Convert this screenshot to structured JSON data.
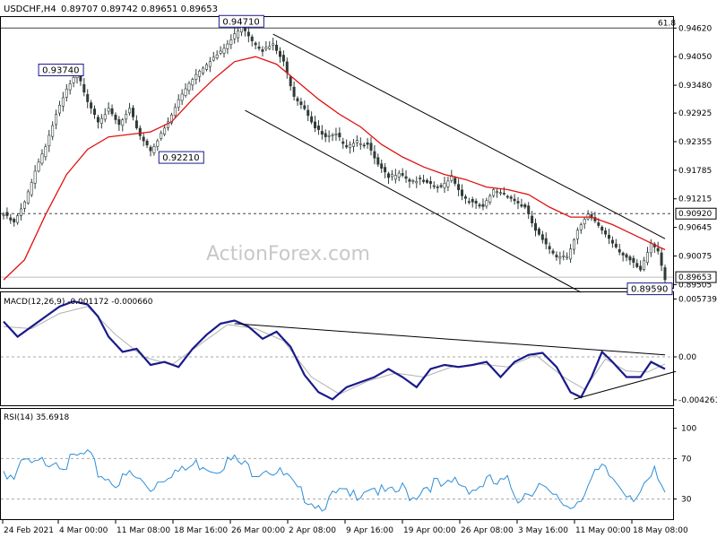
{
  "header": {
    "symbol": "USDCHF,H4",
    "ohlc": "0.89707 0.89742 0.89651 0.89653"
  },
  "watermark": "ActionForex.com",
  "colors": {
    "background": "#ffffff",
    "candles": "#2e3a36",
    "ema": "#e01010",
    "channel": "#000000",
    "macd": "#1a1a8c",
    "signal": "#b0b0b0",
    "rsi": "#2f8fd8",
    "level": "#444444",
    "label_border": "#1a1a8c"
  },
  "chart_data": [
    {
      "type": "candlestick",
      "name": "price",
      "ylim": [
        0.8944,
        0.9484
      ],
      "price_ticks": [
        "0.94620",
        "0.94050",
        "0.93480",
        "0.92925",
        "0.92355",
        "0.91785",
        "0.91215",
        "0.90645",
        "0.90075",
        "0.89505"
      ],
      "fib_label": "61.8",
      "fib_level": 0.9462,
      "h_level": 0.9092,
      "h_level_label": "0.90920",
      "current_price_label": "0.89653",
      "current_price": 0.89653,
      "annotations": [
        {
          "text": "0.94710",
          "value": 0.9471,
          "date": "26 Mar 00:00"
        },
        {
          "text": "0.93740",
          "value": 0.9374,
          "date": "4 Mar 00:00"
        },
        {
          "text": "0.92210",
          "value": 0.9221,
          "date": "18 Mar 16:00"
        },
        {
          "text": "0.89590",
          "value": 0.8959,
          "date": "18 May 08:00"
        }
      ],
      "x_labels": [
        "24 Feb 2021",
        "4 Mar 00:00",
        "11 Mar 08:00",
        "18 Mar 16:00",
        "26 Mar 00:00",
        "2 Apr 08:00",
        "9 Apr 16:00",
        "19 Apr 00:00",
        "26 Apr 08:00",
        "3 May 16:00",
        "11 May 00:00",
        "18 May 08:00"
      ],
      "price_path": [
        [
          0,
          0.9092
        ],
        [
          3,
          0.9075
        ],
        [
          6,
          0.9115
        ],
        [
          9,
          0.918
        ],
        [
          12,
          0.923
        ],
        [
          15,
          0.929
        ],
        [
          18,
          0.934
        ],
        [
          21,
          0.9374
        ],
        [
          24,
          0.932
        ],
        [
          27,
          0.928
        ],
        [
          30,
          0.93
        ],
        [
          33,
          0.927
        ],
        [
          36,
          0.93
        ],
        [
          39,
          0.925
        ],
        [
          42,
          0.9221
        ],
        [
          44,
          0.924
        ],
        [
          47,
          0.9275
        ],
        [
          50,
          0.932
        ],
        [
          53,
          0.9355
        ],
        [
          56,
          0.938
        ],
        [
          59,
          0.94
        ],
        [
          62,
          0.9415
        ],
        [
          65,
          0.944
        ],
        [
          68,
          0.9471
        ],
        [
          71,
          0.944
        ],
        [
          74,
          0.942
        ],
        [
          77,
          0.943
        ],
        [
          80,
          0.9395
        ],
        [
          83,
          0.933
        ],
        [
          86,
          0.9305
        ],
        [
          89,
          0.9265
        ],
        [
          92,
          0.9245
        ],
        [
          95,
          0.925
        ],
        [
          98,
          0.923
        ],
        [
          101,
          0.924
        ],
        [
          104,
          0.923
        ],
        [
          107,
          0.919
        ],
        [
          110,
          0.9165
        ],
        [
          113,
          0.9178
        ],
        [
          116,
          0.916
        ],
        [
          119,
          0.916
        ],
        [
          122,
          0.915
        ],
        [
          125,
          0.9145
        ],
        [
          128,
          0.917
        ],
        [
          131,
          0.913
        ],
        [
          134,
          0.9115
        ],
        [
          137,
          0.9105
        ],
        [
          140,
          0.914
        ],
        [
          143,
          0.9135
        ],
        [
          146,
          0.912
        ],
        [
          149,
          0.9105
        ],
        [
          152,
          0.906
        ],
        [
          155,
          0.903
        ],
        [
          158,
          0.901
        ],
        [
          161,
          0.901
        ],
        [
          164,
          0.906
        ],
        [
          167,
          0.909
        ],
        [
          170,
          0.907
        ],
        [
          173,
          0.9045
        ],
        [
          176,
          0.902
        ],
        [
          179,
          0.9
        ],
        [
          182,
          0.8979
        ],
        [
          185,
          0.9035
        ],
        [
          187,
          0.902
        ],
        [
          189,
          0.8965
        ]
      ],
      "ema_path": [
        [
          0,
          0.896
        ],
        [
          6,
          0.9
        ],
        [
          12,
          0.909
        ],
        [
          18,
          0.917
        ],
        [
          24,
          0.922
        ],
        [
          30,
          0.9245
        ],
        [
          36,
          0.925
        ],
        [
          42,
          0.9255
        ],
        [
          48,
          0.9275
        ],
        [
          54,
          0.932
        ],
        [
          60,
          0.936
        ],
        [
          66,
          0.9395
        ],
        [
          72,
          0.9405
        ],
        [
          78,
          0.939
        ],
        [
          84,
          0.9355
        ],
        [
          90,
          0.932
        ],
        [
          96,
          0.929
        ],
        [
          102,
          0.9265
        ],
        [
          108,
          0.923
        ],
        [
          114,
          0.9205
        ],
        [
          120,
          0.9185
        ],
        [
          126,
          0.917
        ],
        [
          132,
          0.916
        ],
        [
          138,
          0.9145
        ],
        [
          144,
          0.914
        ],
        [
          150,
          0.913
        ],
        [
          156,
          0.9105
        ],
        [
          162,
          0.9085
        ],
        [
          168,
          0.9085
        ],
        [
          174,
          0.907
        ],
        [
          180,
          0.905
        ],
        [
          186,
          0.903
        ],
        [
          189,
          0.902
        ]
      ],
      "channel_upper": [
        [
          77,
          0.945
        ],
        [
          189,
          0.9042
        ]
      ],
      "channel_lower": [
        [
          69,
          0.9298
        ],
        [
          165,
          0.8935
        ]
      ]
    },
    {
      "type": "line",
      "name": "MACD(12,26,9)",
      "header": "MACD(12,26,9) -0.001172 -0.000660",
      "ylim": [
        -0.0048,
        0.0064
      ],
      "ticks": [
        "0.005739",
        "0.00",
        "-0.004261"
      ],
      "macd_path": [
        [
          0,
          0.0035
        ],
        [
          4,
          0.002
        ],
        [
          8,
          0.003
        ],
        [
          12,
          0.004
        ],
        [
          16,
          0.005
        ],
        [
          20,
          0.0055
        ],
        [
          24,
          0.0052
        ],
        [
          27,
          0.004
        ],
        [
          30,
          0.002
        ],
        [
          34,
          0.0005
        ],
        [
          38,
          0.0008
        ],
        [
          42,
          -0.0008
        ],
        [
          46,
          -0.0005
        ],
        [
          50,
          -0.001
        ],
        [
          54,
          0.0008
        ],
        [
          58,
          0.0022
        ],
        [
          62,
          0.0033
        ],
        [
          66,
          0.0036
        ],
        [
          70,
          0.003
        ],
        [
          74,
          0.0018
        ],
        [
          78,
          0.0025
        ],
        [
          82,
          0.001
        ],
        [
          86,
          -0.0018
        ],
        [
          90,
          -0.0035
        ],
        [
          94,
          -0.0042
        ],
        [
          98,
          -0.003
        ],
        [
          102,
          -0.0025
        ],
        [
          106,
          -0.002
        ],
        [
          110,
          -0.0012
        ],
        [
          114,
          -0.002
        ],
        [
          118,
          -0.003
        ],
        [
          122,
          -0.0012
        ],
        [
          126,
          -0.0008
        ],
        [
          130,
          -0.001
        ],
        [
          134,
          -0.0008
        ],
        [
          138,
          -0.0005
        ],
        [
          142,
          -0.002
        ],
        [
          146,
          -0.0005
        ],
        [
          150,
          0.0002
        ],
        [
          154,
          0.0004
        ],
        [
          158,
          -0.001
        ],
        [
          162,
          -0.0035
        ],
        [
          165,
          -0.004
        ],
        [
          168,
          -0.002
        ],
        [
          171,
          0.0005
        ],
        [
          174,
          -0.0005
        ],
        [
          178,
          -0.002
        ],
        [
          182,
          -0.002
        ],
        [
          185,
          -0.0005
        ],
        [
          189,
          -0.0012
        ]
      ],
      "signal_path": [
        [
          0,
          0.003
        ],
        [
          8,
          0.0028
        ],
        [
          16,
          0.0043
        ],
        [
          24,
          0.005
        ],
        [
          32,
          0.0022
        ],
        [
          40,
          0.0
        ],
        [
          48,
          -0.0008
        ],
        [
          56,
          0.0012
        ],
        [
          64,
          0.0032
        ],
        [
          72,
          0.0028
        ],
        [
          80,
          0.0016
        ],
        [
          88,
          -0.002
        ],
        [
          96,
          -0.0037
        ],
        [
          104,
          -0.0024
        ],
        [
          112,
          -0.0016
        ],
        [
          120,
          -0.002
        ],
        [
          128,
          -0.001
        ],
        [
          136,
          -0.0007
        ],
        [
          144,
          -0.001
        ],
        [
          152,
          0.0002
        ],
        [
          160,
          -0.002
        ],
        [
          166,
          -0.0032
        ],
        [
          172,
          -0.0002
        ],
        [
          178,
          -0.0014
        ],
        [
          184,
          -0.0015
        ],
        [
          189,
          -0.0007
        ]
      ],
      "trend_upper": [
        [
          66,
          0.0033
        ],
        [
          189,
          0.0002
        ]
      ],
      "trend_lower": [
        [
          163,
          -0.0042
        ],
        [
          189,
          -0.0018
        ]
      ]
    },
    {
      "type": "line",
      "name": "RSI(14)",
      "header": "RSI(14) 35.6918",
      "ylim": [
        0,
        100
      ],
      "ticks": [
        "100",
        "70",
        "30"
      ],
      "levels": [
        70,
        30
      ],
      "rsi_path": [
        [
          0,
          63
        ],
        [
          3,
          55
        ],
        [
          6,
          70
        ],
        [
          9,
          66
        ],
        [
          12,
          72
        ],
        [
          15,
          74
        ],
        [
          18,
          68
        ],
        [
          21,
          75
        ],
        [
          24,
          78
        ],
        [
          27,
          60
        ],
        [
          30,
          54
        ],
        [
          33,
          50
        ],
        [
          36,
          58
        ],
        [
          39,
          52
        ],
        [
          42,
          45
        ],
        [
          45,
          55
        ],
        [
          48,
          62
        ],
        [
          51,
          60
        ],
        [
          54,
          67
        ],
        [
          57,
          70
        ],
        [
          60,
          64
        ],
        [
          63,
          70
        ],
        [
          66,
          72
        ],
        [
          69,
          66
        ],
        [
          72,
          62
        ],
        [
          75,
          66
        ],
        [
          78,
          60
        ],
        [
          81,
          55
        ],
        [
          84,
          40
        ],
        [
          87,
          36
        ],
        [
          90,
          28
        ],
        [
          93,
          32
        ],
        [
          96,
          40
        ],
        [
          99,
          35
        ],
        [
          102,
          43
        ],
        [
          105,
          48
        ],
        [
          108,
          40
        ],
        [
          111,
          38
        ],
        [
          114,
          44
        ],
        [
          117,
          36
        ],
        [
          120,
          46
        ],
        [
          123,
          50
        ],
        [
          126,
          43
        ],
        [
          129,
          52
        ],
        [
          132,
          47
        ],
        [
          135,
          44
        ],
        [
          138,
          52
        ],
        [
          141,
          48
        ],
        [
          144,
          50
        ],
        [
          147,
          36
        ],
        [
          150,
          42
        ],
        [
          153,
          48
        ],
        [
          156,
          36
        ],
        [
          159,
          32
        ],
        [
          162,
          26
        ],
        [
          165,
          38
        ],
        [
          168,
          52
        ],
        [
          171,
          63
        ],
        [
          174,
          54
        ],
        [
          177,
          45
        ],
        [
          180,
          38
        ],
        [
          183,
          42
        ],
        [
          186,
          60
        ],
        [
          189,
          36
        ]
      ]
    }
  ]
}
